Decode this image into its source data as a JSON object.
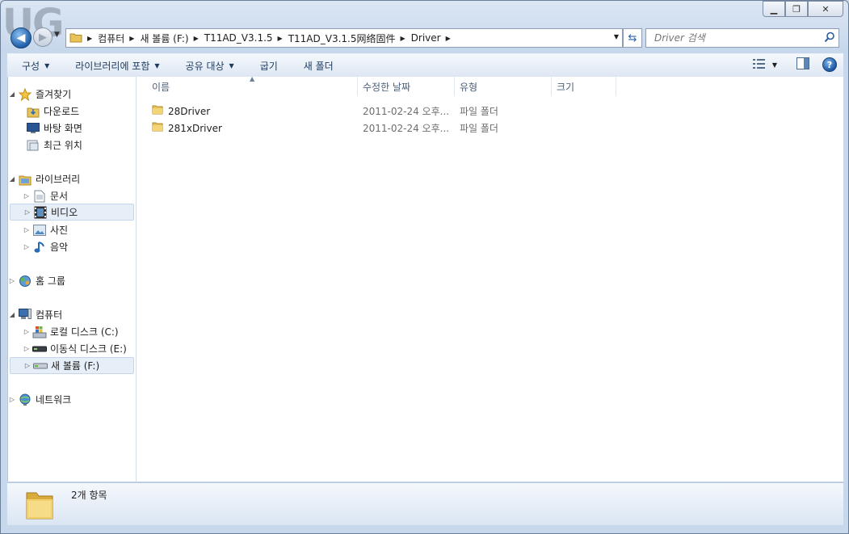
{
  "window": {
    "minimize": "▁",
    "maximize": "❐",
    "close": "✕"
  },
  "address": {
    "crumbs": [
      "컴퓨터",
      "새 볼륨 (F:)",
      "T11AD_V3.1.5",
      "T11AD_V3.1.5网络固件",
      "Driver"
    ],
    "search_placeholder": "Driver 검색"
  },
  "toolbar": {
    "organize": "구성",
    "include_library": "라이브러리에 포함",
    "share": "공유 대상",
    "burn": "굽기",
    "new_folder": "새 폴더"
  },
  "nav": {
    "favorites": "즐겨찾기",
    "downloads": "다운로드",
    "desktop": "바탕 화면",
    "recent": "최근 위치",
    "libraries": "라이브러리",
    "documents": "문서",
    "videos": "비디오",
    "pictures": "사진",
    "music": "음악",
    "homegroup": "홈 그룹",
    "computer": "컴퓨터",
    "local_disk": "로컬 디스크 (C:)",
    "removable": "이동식 디스크 (E:)",
    "new_volume": "새 볼륨 (F:)",
    "network": "네트워크"
  },
  "columns": {
    "name": "이름",
    "date": "수정한 날짜",
    "type": "유형",
    "size": "크기"
  },
  "files": [
    {
      "name": "28Driver",
      "date": "2011-02-24 오후...",
      "type": "파일 폴더"
    },
    {
      "name": "281xDriver",
      "date": "2011-02-24 오후...",
      "type": "파일 폴더"
    }
  ],
  "details": {
    "count": "2개 항목"
  }
}
